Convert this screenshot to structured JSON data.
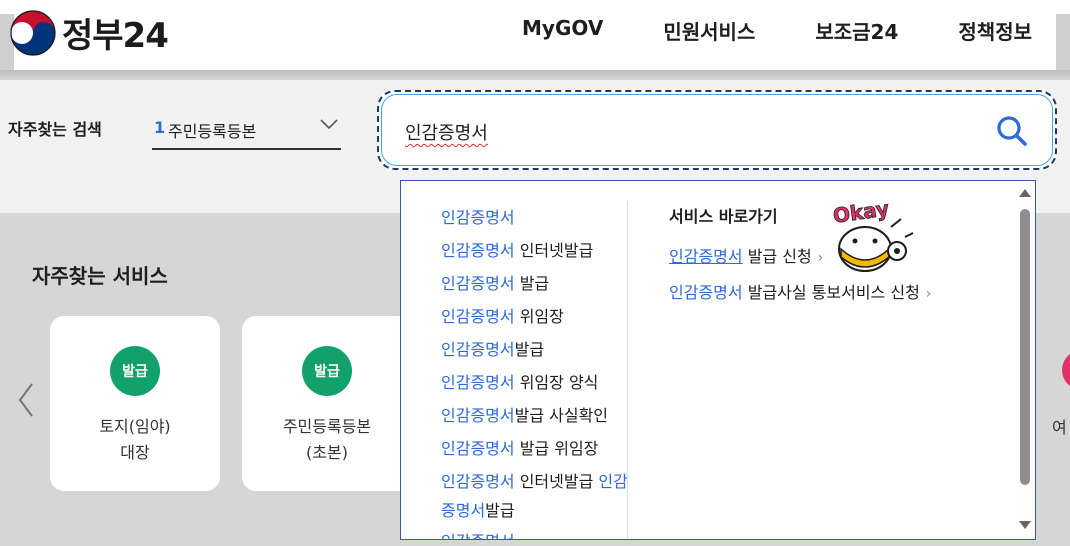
{
  "header": {
    "logo_text": "정부24",
    "nav": [
      "MyGOV",
      "민원서비스",
      "보조금24",
      "정책정보"
    ]
  },
  "search": {
    "frequent_label": "자주찾는 검색",
    "frequent_rank": "1",
    "frequent_value": "주민등록등본",
    "query": "인감증명서"
  },
  "autocomplete": {
    "items": [
      {
        "hl": "인감증명서",
        "rest": ""
      },
      {
        "hl": "인감증명서",
        "rest": " 인터넷발급"
      },
      {
        "hl": "인감증명서",
        "rest": " 발급"
      },
      {
        "hl": "인감증명서",
        "rest": " 위임장"
      },
      {
        "hl": "인감증명서",
        "rest": "발급"
      },
      {
        "hl": "인감증명서",
        "rest": " 위임장 양식"
      },
      {
        "hl": "인감증명서",
        "rest": "발급 사실확인"
      },
      {
        "hl": "인감증명서",
        "rest": " 발급 위임장"
      }
    ],
    "wrap_item": {
      "hl1": "인감증명서",
      "mid": " 인터넷발급 ",
      "hl2": "인감증명서",
      "rest": "발급"
    },
    "cut_item": "인감증명서",
    "shortcut_title": "서비스 바로가기",
    "shortcuts": [
      {
        "hl": "인감증명서",
        "rest": " 발급 신청"
      },
      {
        "hl": "인감증명서",
        "rest": " 발급사실 통보서비스 신청"
      }
    ],
    "chevron": "›",
    "mascot_text": "Okay"
  },
  "services": {
    "title": "자주찾는 서비스",
    "cards": [
      {
        "badge": "발급",
        "title": "토지(임야)\n대장"
      },
      {
        "badge": "발급",
        "title": "주민등록등본\n(초본)"
      }
    ],
    "edge_text": "여"
  },
  "colors": {
    "accent_blue": "#2d6bd8",
    "badge_green": "#12a16b",
    "focus_border": "#1a3a6b"
  }
}
